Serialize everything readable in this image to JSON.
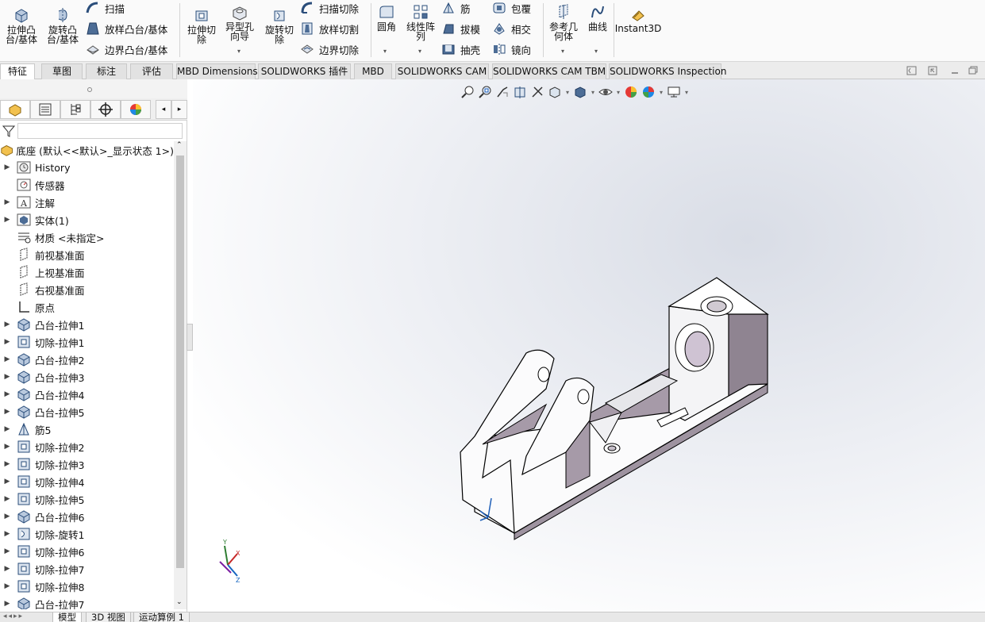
{
  "ribbon": {
    "extrude_boss": "拉伸凸\n台/基体",
    "revolve_boss": "旋转凸\n台/基体",
    "sweep": "扫描",
    "loft_boss": "放样凸台/基体",
    "boundary_boss": "边界凸台/基体",
    "extrude_cut": "拉伸切\n除",
    "hole_wizard": "异型孔\n向导",
    "revolve_cut": "旋转切\n除",
    "sweep_cut": "扫描切除",
    "loft_cut": "放样切割",
    "boundary_cut": "边界切除",
    "fillet": "圆角",
    "linear_pattern": "线性阵\n列",
    "rib": "筋",
    "draft": "拔模",
    "shell": "抽壳",
    "wrap": "包覆",
    "intersect": "相交",
    "mirror": "镜向",
    "ref_geometry": "参考几\n何体",
    "curves": "曲线",
    "instant3d": "Instant3D"
  },
  "tabs": [
    "特征",
    "草图",
    "标注",
    "评估",
    "MBD Dimensions",
    "SOLIDWORKS 插件",
    "MBD",
    "SOLIDWORKS CAM",
    "SOLIDWORKS CAM TBM",
    "SOLIDWORKS Inspection"
  ],
  "tree": {
    "root": "底座 (默认<<默认>_显示状态 1>)",
    "items": [
      {
        "label": "History",
        "arrow": true,
        "icon": "history-icon"
      },
      {
        "label": "传感器",
        "arrow": false,
        "icon": "sensor-icon"
      },
      {
        "label": "注解",
        "arrow": true,
        "icon": "annotation-icon"
      },
      {
        "label": "实体(1)",
        "arrow": true,
        "icon": "solid-body-icon"
      },
      {
        "label": "材质 <未指定>",
        "arrow": false,
        "icon": "material-icon"
      },
      {
        "label": "前视基准面",
        "arrow": false,
        "icon": "plane-icon"
      },
      {
        "label": "上视基准面",
        "arrow": false,
        "icon": "plane-icon"
      },
      {
        "label": "右视基准面",
        "arrow": false,
        "icon": "plane-icon"
      },
      {
        "label": "原点",
        "arrow": false,
        "icon": "origin-icon"
      },
      {
        "label": "凸台-拉伸1",
        "arrow": true,
        "icon": "boss-extrude-icon"
      },
      {
        "label": "切除-拉伸1",
        "arrow": true,
        "icon": "cut-extrude-icon"
      },
      {
        "label": "凸台-拉伸2",
        "arrow": true,
        "icon": "boss-extrude-icon"
      },
      {
        "label": "凸台-拉伸3",
        "arrow": true,
        "icon": "boss-extrude-icon"
      },
      {
        "label": "凸台-拉伸4",
        "arrow": true,
        "icon": "boss-extrude-icon"
      },
      {
        "label": "凸台-拉伸5",
        "arrow": true,
        "icon": "boss-extrude-icon"
      },
      {
        "label": "筋5",
        "arrow": true,
        "icon": "rib-icon"
      },
      {
        "label": "切除-拉伸2",
        "arrow": true,
        "icon": "cut-extrude-icon"
      },
      {
        "label": "切除-拉伸3",
        "arrow": true,
        "icon": "cut-extrude-icon"
      },
      {
        "label": "切除-拉伸4",
        "arrow": true,
        "icon": "cut-extrude-icon"
      },
      {
        "label": "切除-拉伸5",
        "arrow": true,
        "icon": "cut-extrude-icon"
      },
      {
        "label": "凸台-拉伸6",
        "arrow": true,
        "icon": "boss-extrude-icon"
      },
      {
        "label": "切除-旋转1",
        "arrow": true,
        "icon": "cut-revolve-icon"
      },
      {
        "label": "切除-拉伸6",
        "arrow": true,
        "icon": "cut-extrude-icon"
      },
      {
        "label": "切除-拉伸7",
        "arrow": true,
        "icon": "cut-extrude-icon"
      },
      {
        "label": "切除-拉伸8",
        "arrow": true,
        "icon": "cut-extrude-icon"
      },
      {
        "label": "凸台-拉伸7",
        "arrow": true,
        "icon": "boss-extrude-icon"
      }
    ]
  },
  "bottom_tabs": [
    "模型",
    "3D 视图",
    "运动算例 1"
  ],
  "colors": {
    "accent": "#1f5fb8",
    "part_side": "#9e93a0",
    "part_top": "#ffffff",
    "active_tab": "#ffffff"
  }
}
